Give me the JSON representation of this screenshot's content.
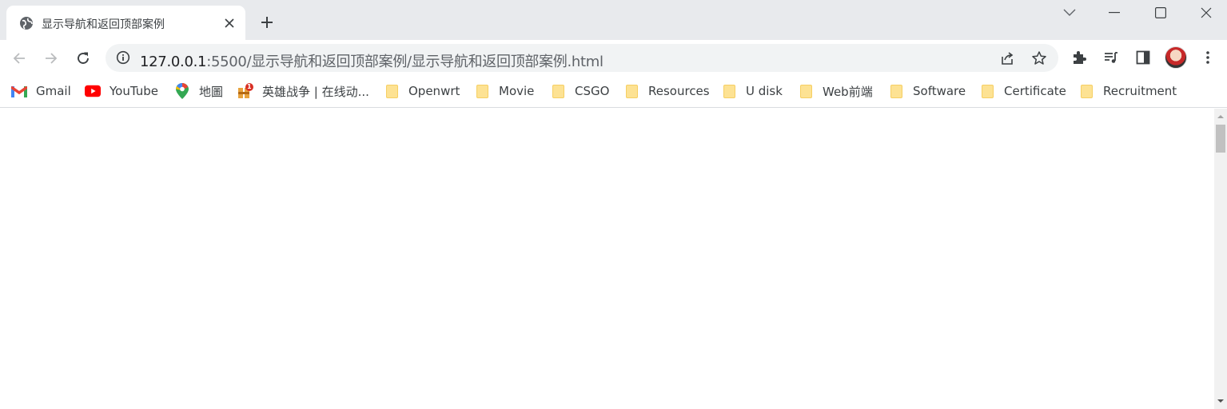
{
  "tab": {
    "title": "显示导航和返回顶部案例"
  },
  "omnibox": {
    "url_host": "127.0.0.1",
    "url_rest": ":5500/显示导航和返回顶部案例/显示导航和返回顶部案例.html"
  },
  "bookmarks": [
    {
      "label": "Gmail",
      "icon": "gmail-icon"
    },
    {
      "label": "YouTube",
      "icon": "youtube-icon"
    },
    {
      "label": "地圖",
      "icon": "maps-icon"
    },
    {
      "label": "英雄战争 | 在线动...",
      "icon": "game-icon"
    },
    {
      "label": "Openwrt",
      "icon": "folder-icon"
    },
    {
      "label": "Movie",
      "icon": "folder-icon"
    },
    {
      "label": "CSGO",
      "icon": "folder-icon"
    },
    {
      "label": "Resources",
      "icon": "folder-icon"
    },
    {
      "label": "U disk",
      "icon": "folder-icon"
    },
    {
      "label": "Web前端",
      "icon": "folder-icon"
    },
    {
      "label": "Software",
      "icon": "folder-icon"
    },
    {
      "label": "Certificate",
      "icon": "folder-icon"
    },
    {
      "label": "Recruitment",
      "icon": "folder-icon"
    }
  ],
  "game_badge": "1",
  "colors": {
    "tabstrip": "#e8eaed",
    "omnibox": "#f1f3f4",
    "folder": "#fde293"
  }
}
